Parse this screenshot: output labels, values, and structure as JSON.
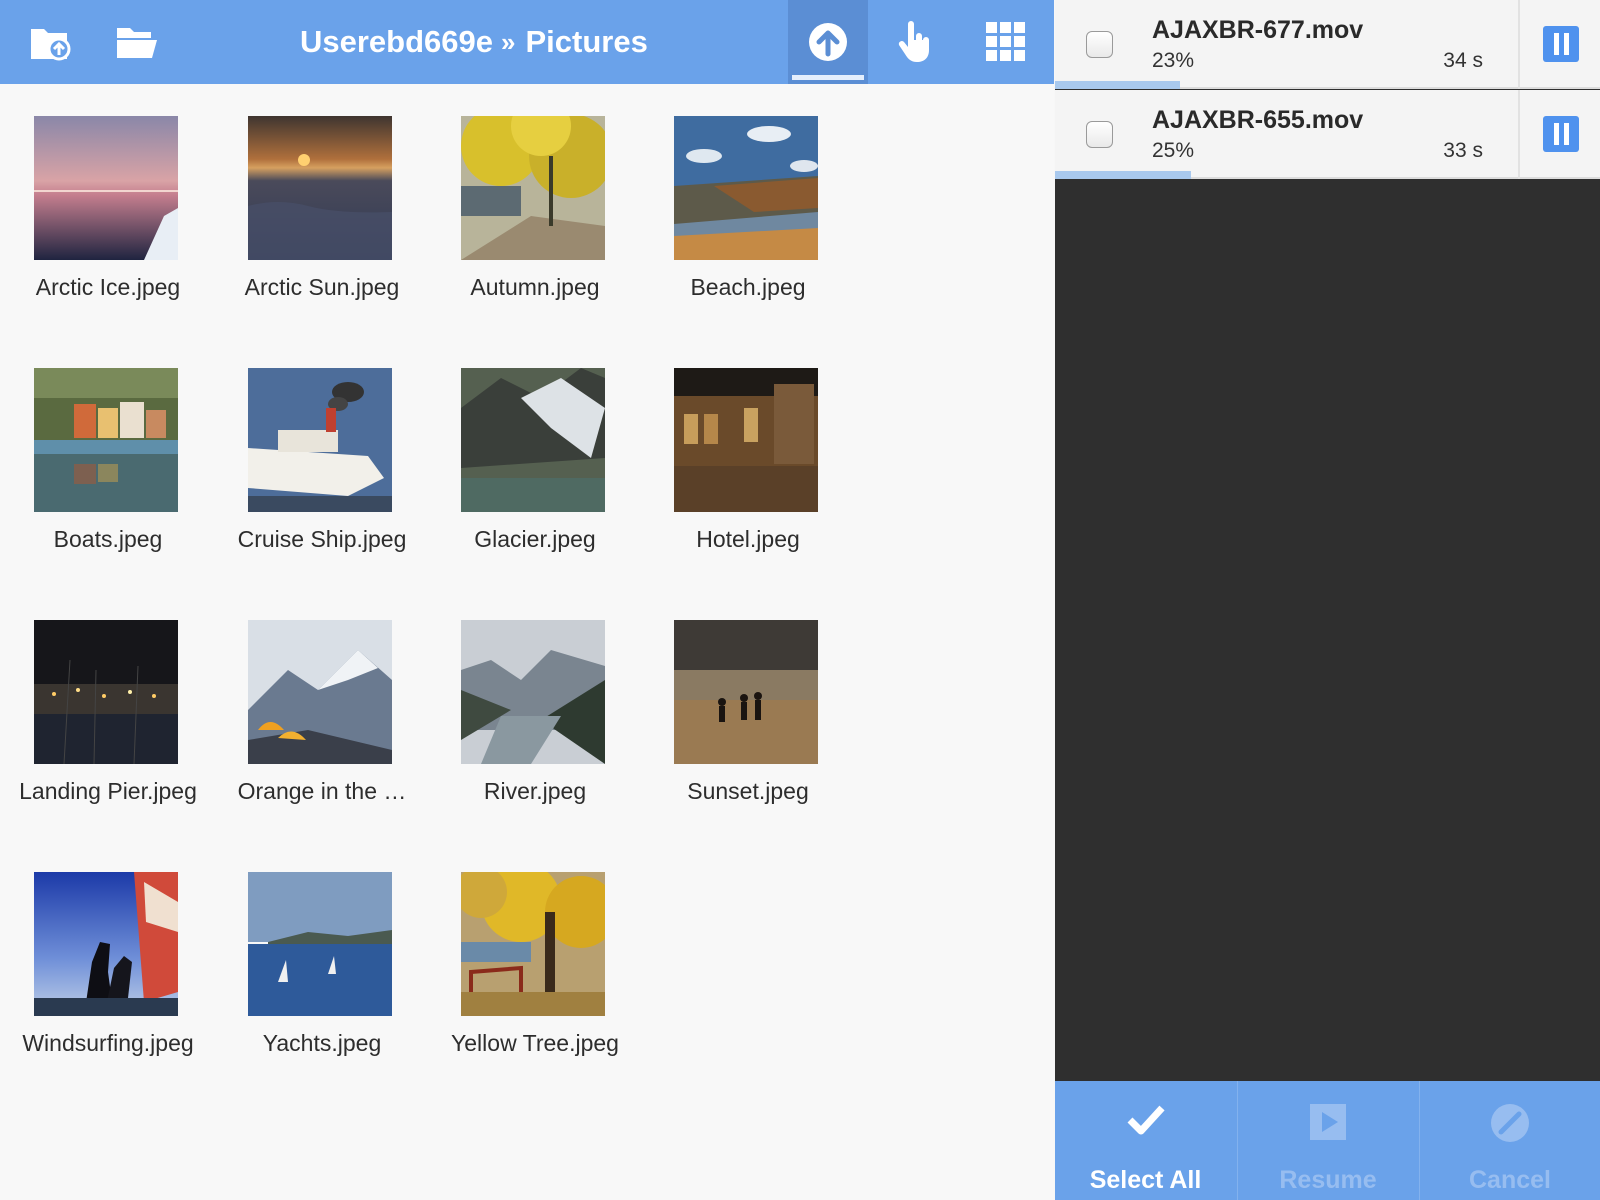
{
  "header": {
    "user": "Userebd669e",
    "separator": "»",
    "folder": "Pictures"
  },
  "toolbar": {
    "icons": [
      "folder-upload-icon",
      "folder-open-icon",
      "upload-icon",
      "touch-icon",
      "grid-icon"
    ],
    "active": "upload"
  },
  "files": [
    {
      "name": "Arctic Ice.jpeg"
    },
    {
      "name": "Arctic Sun.jpeg"
    },
    {
      "name": "Autumn.jpeg"
    },
    {
      "name": "Beach.jpeg"
    },
    {
      "name": "Boats.jpeg"
    },
    {
      "name": "Cruise Ship.jpeg"
    },
    {
      "name": "Glacier.jpeg"
    },
    {
      "name": "Hotel.jpeg"
    },
    {
      "name": "Landing Pier.jpeg"
    },
    {
      "name": "Orange in the …"
    },
    {
      "name": "River.jpeg"
    },
    {
      "name": "Sunset.jpeg"
    },
    {
      "name": "Windsurfing.jpeg"
    },
    {
      "name": "Yachts.jpeg"
    },
    {
      "name": "Yellow Tree.jpeg"
    }
  ],
  "queue": [
    {
      "name": "AJAXBR-677.mov",
      "percent": "23%",
      "progress": 0.23,
      "time": "34 s"
    },
    {
      "name": "AJAXBR-655.mov",
      "percent": "25%",
      "progress": 0.25,
      "time": "33 s"
    }
  ],
  "actions": {
    "select_all": "Select All",
    "resume": "Resume",
    "cancel": "Cancel"
  },
  "colors": {
    "accent": "#6aa2ea",
    "pause_button": "#4f92ee",
    "progress": "#a9c9ee",
    "queue_background": "#2f2f2f",
    "disabled_label": "#97bdf0"
  }
}
